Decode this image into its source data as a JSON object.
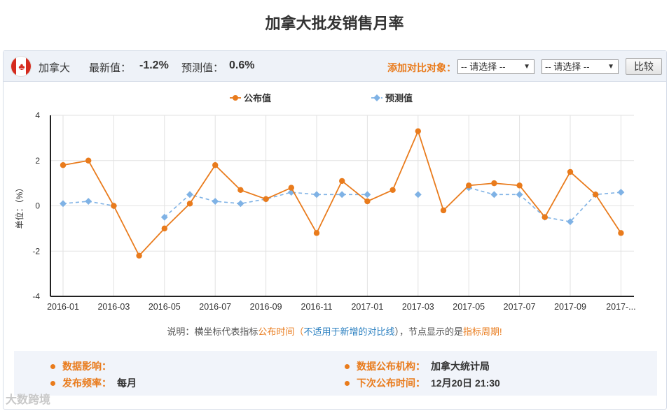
{
  "page": {
    "title": "加拿大批发销售月率"
  },
  "header": {
    "country": "加拿大",
    "latest_label": "最新值：",
    "latest_value": "-1.2%",
    "forecast_label": "预测值：",
    "forecast_value": "0.6%",
    "compare_label": "添加对比对象：",
    "select1": "-- 请选择 --",
    "select2": "-- 请选择 --",
    "compare_button": "比较"
  },
  "note": {
    "p1": "说明：横坐标代表指标",
    "p2": "公布时间",
    "p3": "（",
    "p4": "不适用于新增的对比线",
    "p5": "），节点显示的是",
    "p6": "指标周期",
    "p7": "!"
  },
  "info": {
    "impact_label": "数据影响：",
    "impact_value": "",
    "freq_label": "发布频率：",
    "freq_value": "每月",
    "agency_label": "数据公布机构：",
    "agency_value": "加拿大统计局",
    "next_label": "下次公布时间：",
    "next_value": "12月20日 21:30"
  },
  "watermark": "大数跨境",
  "chart_data": {
    "type": "line",
    "ylabel": "单位：（%）",
    "ylim": [
      -4,
      4
    ],
    "yticks": [
      -4,
      -2,
      0,
      2,
      4
    ],
    "grid": true,
    "legend_position": "top",
    "x": [
      "2016-01",
      "2016-02",
      "2016-03",
      "2016-04",
      "2016-05",
      "2016-06",
      "2016-07",
      "2016-08",
      "2016-09",
      "2016-10",
      "2016-11",
      "2016-12",
      "2017-01",
      "2017-02",
      "2017-03",
      "2017-04",
      "2017-05",
      "2017-06",
      "2017-07",
      "2017-08",
      "2017-09",
      "2017-10",
      "2017-11"
    ],
    "xtick_labels": [
      "2016-01",
      "2016-03",
      "2016-05",
      "2016-07",
      "2016-09",
      "2016-11",
      "2017-01",
      "2017-03",
      "2017-05",
      "2017-07",
      "2017-09",
      "2017-..."
    ],
    "series": [
      {
        "name": "公布值",
        "color": "#e97b1c",
        "dashed": false,
        "values": [
          1.8,
          2.0,
          0.0,
          -2.2,
          -1.0,
          0.1,
          1.8,
          0.7,
          0.3,
          0.8,
          -1.2,
          1.1,
          0.2,
          0.7,
          3.3,
          -0.2,
          0.9,
          1.0,
          0.9,
          -0.5,
          1.5,
          0.5,
          -1.2
        ]
      },
      {
        "name": "预测值",
        "color": "#7fb2e5",
        "dashed": true,
        "values": [
          0.1,
          0.2,
          0.0,
          null,
          -0.5,
          0.5,
          0.2,
          0.1,
          0.3,
          0.6,
          0.5,
          0.5,
          0.5,
          null,
          0.5,
          null,
          0.8,
          0.5,
          0.5,
          -0.5,
          -0.7,
          0.5,
          0.6
        ]
      }
    ]
  }
}
